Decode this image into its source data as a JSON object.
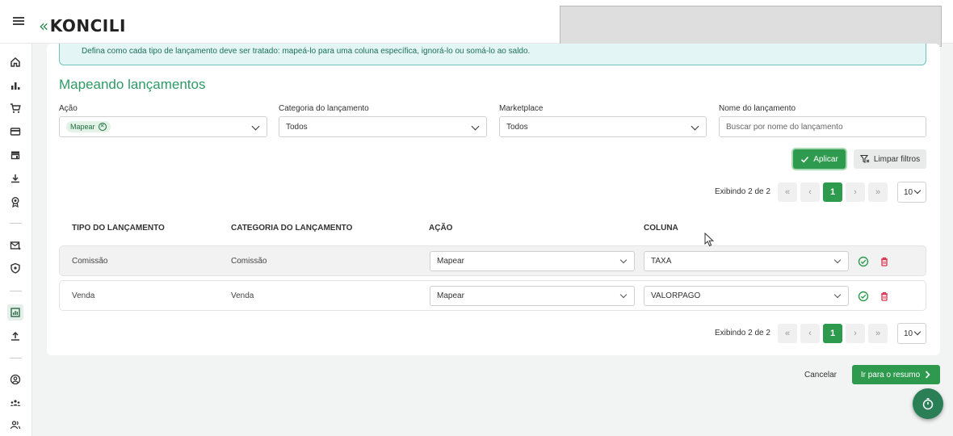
{
  "header": {
    "logo_text": "KONCILI"
  },
  "info_banner": {
    "text": "Defina como cada tipo de lançamento deve ser tratado: mapeá-lo para uma coluna específica, ignorá-lo ou somá-lo ao saldo."
  },
  "section": {
    "title": "Mapeando lançamentos"
  },
  "filters": {
    "acao_label": "Ação",
    "acao_chip": "Mapear",
    "categoria_label": "Categoria do lançamento",
    "categoria_value": "Todos",
    "marketplace_label": "Marketplace",
    "marketplace_value": "Todos",
    "nome_label": "Nome do lançamento",
    "nome_placeholder": "Buscar por nome do lançamento",
    "apply_label": "Aplicar",
    "clear_label": "Limpar filtros"
  },
  "pagination": {
    "info": "Exibindo 2 de 2",
    "first": "«",
    "prev": "‹",
    "current": "1",
    "next": "›",
    "last": "»",
    "page_size": "10"
  },
  "table": {
    "headers": [
      "TIPO DO LANÇAMENTO",
      "CATEGORIA DO LANÇAMENTO",
      "AÇÃO",
      "COLUNA"
    ],
    "rows": [
      {
        "tipo": "Comissão",
        "categoria": "Comissão",
        "acao": "Mapear",
        "coluna": "TAXA"
      },
      {
        "tipo": "Venda",
        "categoria": "Venda",
        "acao": "Mapear",
        "coluna": "VALORPAGO"
      }
    ]
  },
  "footer": {
    "cancel_label": "Cancelar",
    "next_label": "Ir para o resumo"
  },
  "colors": {
    "primary": "#2e9a4e",
    "title": "#2e9a66",
    "banner_bg": "#e3f5f4",
    "banner_border": "#6fc3bd",
    "delete": "#d9304a"
  },
  "icons": {
    "sidebar": [
      "home-icon",
      "bar-chart-icon",
      "cart-icon",
      "credit-card-icon",
      "store-icon",
      "download-icon",
      "award-icon",
      "mail-send-icon",
      "shield-icon",
      "report-icon",
      "upload-icon",
      "user-circle-icon",
      "team-icon",
      "users-icon"
    ]
  }
}
